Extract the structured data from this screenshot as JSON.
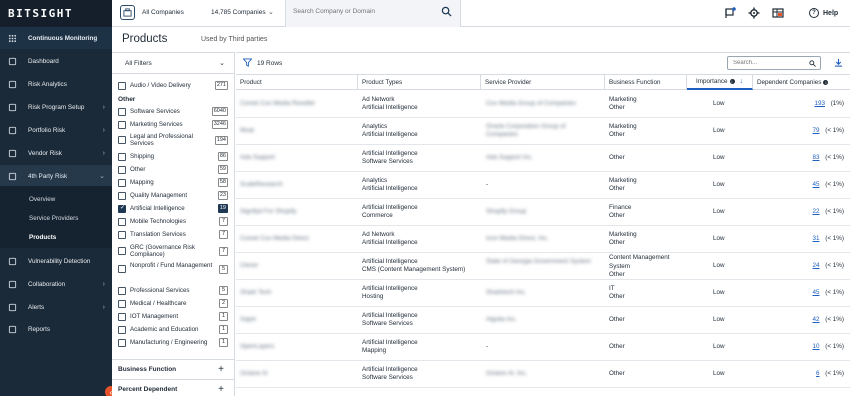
{
  "brand": "BITSIGHT",
  "nav": {
    "continuous_monitoring": "Continuous Monitoring",
    "items": [
      {
        "label": "Dashboard",
        "icon": "home-icon",
        "chevron": false
      },
      {
        "label": "Risk Analytics",
        "icon": "trend-icon",
        "chevron": false
      },
      {
        "label": "Risk Program Setup",
        "icon": "settings-icon",
        "chevron": true
      },
      {
        "label": "Portfolio Risk",
        "icon": "briefcase-icon",
        "chevron": true
      },
      {
        "label": "Vendor Risk",
        "icon": "truck-icon",
        "chevron": true
      },
      {
        "label": "4th Party Risk",
        "icon": "network-icon",
        "chevron": true
      }
    ],
    "sub_items": [
      "Overview",
      "Service Providers",
      "Products"
    ],
    "lower_items": [
      {
        "label": "Vulnerability Detection",
        "icon": "radar-icon",
        "chevron": false
      },
      {
        "label": "Collaboration",
        "icon": "mail-icon",
        "chevron": true
      },
      {
        "label": "Alerts",
        "icon": "bell-icon",
        "chevron": true
      },
      {
        "label": "Reports",
        "icon": "report-icon",
        "chevron": false
      }
    ]
  },
  "topbar": {
    "company_label": "All Companies",
    "company_count": "14,785 Companies",
    "search_placeholder": "Search Company or Domain",
    "help": "Help"
  },
  "page": {
    "title": "Products",
    "subtitle": "Used by Third parties"
  },
  "filters": {
    "all_filters": "All Filters",
    "top_item": {
      "label": "Audio / Video Delivery",
      "count": "271",
      "checked": false
    },
    "group_label": "Other",
    "items": [
      {
        "label": "Software Services",
        "count": "6040",
        "checked": false
      },
      {
        "label": "Marketing Services",
        "count": "3246",
        "checked": false
      },
      {
        "label": "Legal and Professional Services",
        "count": "194",
        "checked": false
      },
      {
        "label": "Shipping",
        "count": "86",
        "checked": false
      },
      {
        "label": "Other",
        "count": "59",
        "checked": false
      },
      {
        "label": "Mapping",
        "count": "58",
        "checked": false
      },
      {
        "label": "Quality Management",
        "count": "23",
        "checked": false
      },
      {
        "label": "Artificial Intelligence",
        "count": "19",
        "checked": true
      },
      {
        "label": "Mobile Technologies",
        "count": "7",
        "checked": false
      },
      {
        "label": "Translation Services",
        "count": "7",
        "checked": false
      },
      {
        "label": "GRC (Governance Risk Compliance)",
        "count": "7",
        "checked": false
      },
      {
        "label": "Nonprofit / Fund Management",
        "count": "5",
        "checked": false
      },
      {
        "label": "Professional Services",
        "count": "5",
        "checked": false
      },
      {
        "label": "Medical / Healthcare",
        "count": "2",
        "checked": false
      },
      {
        "label": "IOT Management",
        "count": "1",
        "checked": false
      },
      {
        "label": "Academic and Education",
        "count": "1",
        "checked": false
      },
      {
        "label": "Manufacturing / Engineering",
        "count": "1",
        "checked": false
      }
    ],
    "sections": [
      "Business Function",
      "Percent Dependent"
    ]
  },
  "table": {
    "rows_count": "19 Rows",
    "search_placeholder": "Search...",
    "headers": {
      "product": "Product",
      "product_types": "Product Types",
      "service_provider": "Service Provider",
      "business_function": "Business Function",
      "importance": "Importance",
      "dependent": "Dependent Companies"
    },
    "rows": [
      {
        "product": "Comet Cox Media Reseller",
        "types": [
          "Ad Network",
          "Artificial Intelligence"
        ],
        "provider": "Cox Media Group of Companies",
        "bf": [
          "Marketing",
          "Other"
        ],
        "importance": "Low",
        "dep_count": "193",
        "dep_pct": "(1%)"
      },
      {
        "product": "Moat",
        "types": [
          "Analytics",
          "Artificial Intelligence"
        ],
        "provider": "Oracle Corporation Group of Companies",
        "bf": [
          "Marketing",
          "Other"
        ],
        "importance": "Low",
        "dep_count": "79",
        "dep_pct": "(< 1%)"
      },
      {
        "product": "Ada Support",
        "types": [
          "Artificial Intelligence",
          "Software Services"
        ],
        "provider": "Ada Support Inc.",
        "bf": [
          "Other"
        ],
        "importance": "Low",
        "dep_count": "83",
        "dep_pct": "(< 1%)"
      },
      {
        "product": "ScaleResearch",
        "types": [
          "Analytics",
          "Artificial Intelligence"
        ],
        "provider": "-",
        "bf": [
          "Marketing",
          "Other"
        ],
        "importance": "Low",
        "dep_count": "45",
        "dep_pct": "(< 1%)"
      },
      {
        "product": "Signifyd For Shopify",
        "types": [
          "Artificial Intelligence",
          "Commerce"
        ],
        "provider": "Shopify Group",
        "bf": [
          "Finance",
          "Other"
        ],
        "importance": "Low",
        "dep_count": "22",
        "dep_pct": "(< 1%)"
      },
      {
        "product": "Comet Cox Media Direct",
        "types": [
          "Ad Network",
          "Artificial Intelligence"
        ],
        "provider": "Icon Media Direct, Inc.",
        "bf": [
          "Marketing",
          "Other"
        ],
        "importance": "Low",
        "dep_count": "31",
        "dep_pct": "(< 1%)"
      },
      {
        "product": "Clever",
        "types": [
          "Artificial Intelligence",
          "CMS (Content Management System)"
        ],
        "provider": "State of Georgia Government System",
        "bf": [
          "Content Management",
          "System",
          "Other"
        ],
        "importance": "Low",
        "dep_count": "24",
        "dep_pct": "(< 1%)"
      },
      {
        "product": "Shark Tech",
        "types": [
          "Artificial Intelligence",
          "Hosting"
        ],
        "provider": "Sharktech Inc.",
        "bf": [
          "IT",
          "Other"
        ],
        "importance": "Low",
        "dep_count": "45",
        "dep_pct": "(< 1%)"
      },
      {
        "product": "Sapin",
        "types": [
          "Artificial Intelligence",
          "Software Services"
        ],
        "provider": "Algolia Inc.",
        "bf": [
          "Other"
        ],
        "importance": "Low",
        "dep_count": "42",
        "dep_pct": "(< 1%)"
      },
      {
        "product": "OpenLayers",
        "types": [
          "Artificial Intelligence",
          "Mapping"
        ],
        "provider": "-",
        "bf": [
          "Other"
        ],
        "importance": "Low",
        "dep_count": "10",
        "dep_pct": "(< 1%)"
      },
      {
        "product": "Octane AI",
        "types": [
          "Artificial Intelligence",
          "Software Services"
        ],
        "provider": "Octane AI, Inc.",
        "bf": [
          "Other"
        ],
        "importance": "Low",
        "dep_count": "6",
        "dep_pct": "(< 1%)"
      }
    ]
  },
  "colors": {
    "nav_bg": "#1b2a38",
    "accent": "#1f5fbf",
    "collapse": "#e8532b"
  }
}
